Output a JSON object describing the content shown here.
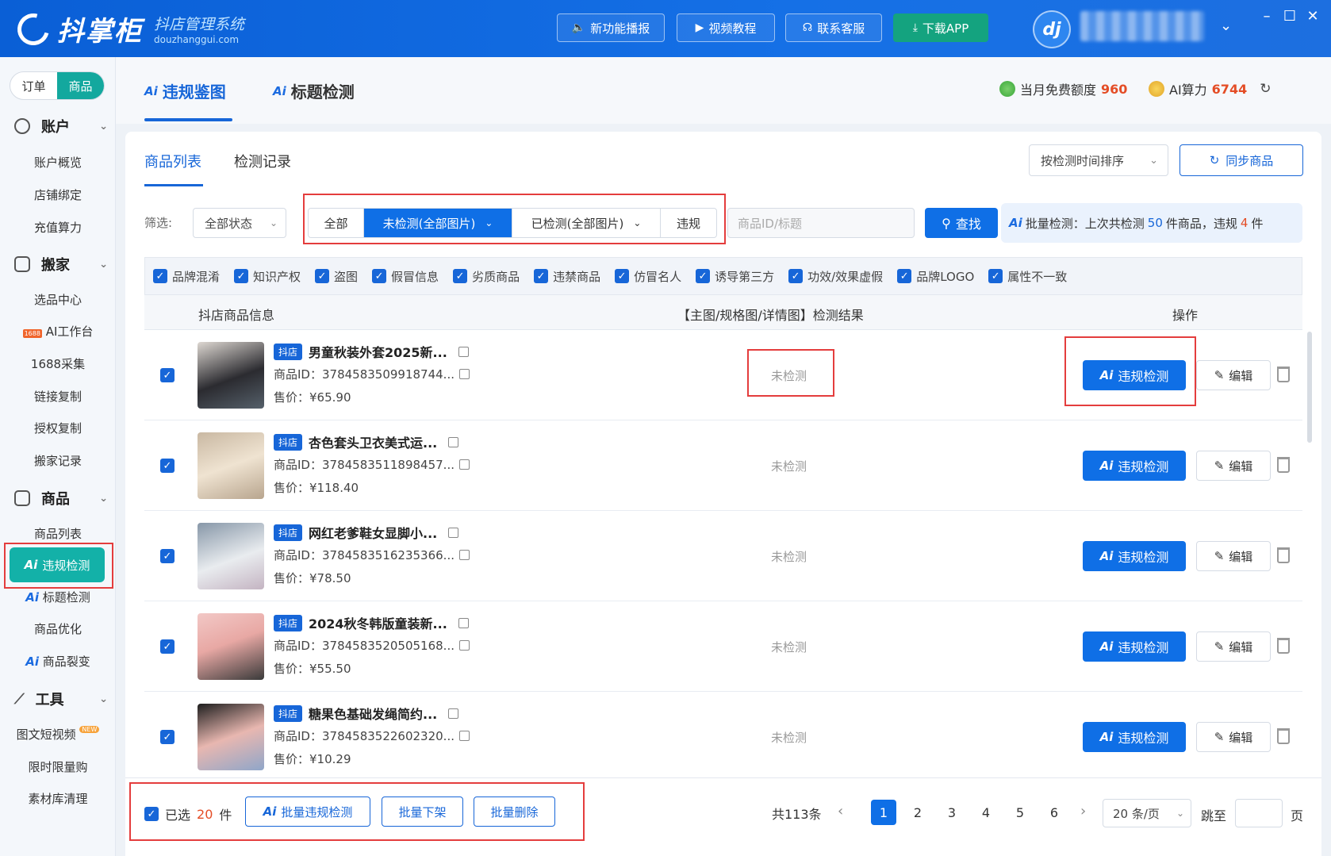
{
  "app": {
    "brand": "抖掌柜",
    "brand_sub": "抖店管理系统",
    "brand_domain": "douzhanggui.com",
    "toolbar": [
      {
        "label": "新功能播报",
        "icon": "speaker-icon"
      },
      {
        "label": "视频教程",
        "icon": "video-icon"
      },
      {
        "label": "联系客服",
        "icon": "headset-icon"
      },
      {
        "label": "下载APP",
        "icon": "download-icon"
      }
    ],
    "user_avatar_text": "dj"
  },
  "sidebar": {
    "segment": {
      "order": "订单",
      "product": "商品"
    },
    "sections": {
      "account": "账户",
      "move": "搬家",
      "goods": "商品",
      "tools": "工具"
    },
    "items": {
      "account_overview": "账户概览",
      "store_bind": "店铺绑定",
      "recharge": "充值算力",
      "select_center": "选品中心",
      "ai_workbench": "AI工作台",
      "collect_1688": "1688采集",
      "link_copy": "链接复制",
      "auth_copy": "授权复制",
      "move_record": "搬家记录",
      "product_list": "商品列表",
      "violation_detect": "违规检测",
      "title_detect": "标题检测",
      "product_optimize": "商品优化",
      "product_split": "商品裂变",
      "short_video": "图文短视频",
      "new_badge": "NEW",
      "flash_sale": "限时限量购",
      "material_clean": "素材库清理"
    },
    "ai_prefix": "Ai",
    "badge_1688": "1688"
  },
  "topnav": {
    "tab_violation": "违规鉴图",
    "tab_title": "标题检测",
    "ai_prefix": "Ai",
    "free_quota_label": "当月免费额度",
    "free_quota_value": "960",
    "ai_power_label": "AI算力",
    "ai_power_value": "6744"
  },
  "content": {
    "tab_list": "商品列表",
    "tab_record": "检测记录",
    "sort_label": "按检测时间排序",
    "sync_label": "同步商品",
    "filter_label": "筛选:",
    "status_select": "全部状态",
    "filters": [
      "全部",
      "未检测(全部图片)",
      "已检测(全部图片)",
      "违规"
    ],
    "search_placeholder": "商品ID/标题",
    "search_button": "查找",
    "batch_info": {
      "prefix": "批量检测：上次共检测",
      "count": "50",
      "mid": "件商品，违规",
      "violations": "4",
      "suffix": "件"
    },
    "categories": [
      "品牌混淆",
      "知识产权",
      "盗图",
      "假冒信息",
      "劣质商品",
      "违禁商品",
      "仿冒名人",
      "诱导第三方",
      "功效/效果虚假",
      "品牌LOGO",
      "属性不一致"
    ],
    "columns": {
      "info": "抖店商品信息",
      "result": "【主图/规格图/详情图】检测结果",
      "action": "操作"
    },
    "row_labels": {
      "tag": "抖店",
      "id_prefix": "商品ID：",
      "price_prefix": "售价：",
      "detect_button": "违规检测",
      "edit_button": "编辑"
    },
    "rows": [
      {
        "title": "男童秋装外套2025新...",
        "id": "3784583509918744...",
        "price": "¥65.90",
        "status": "未检测"
      },
      {
        "title": "杏色套头卫衣美式运...",
        "id": "3784583511898457...",
        "price": "¥118.40",
        "status": "未检测"
      },
      {
        "title": "网红老爹鞋女显脚小...",
        "id": "3784583516235366...",
        "price": "¥78.50",
        "status": "未检测"
      },
      {
        "title": "2024秋冬韩版童装新...",
        "id": "3784583520505168...",
        "price": "¥55.50",
        "status": "未检测"
      },
      {
        "title": "糖果色基础发绳简约...",
        "id": "3784583522602320...",
        "price": "¥10.29",
        "status": "未检测"
      }
    ]
  },
  "footer": {
    "selected_prefix": "已选",
    "selected_count": "20",
    "selected_suffix": "件",
    "batch_detect": "批量违规检测",
    "batch_offshelf": "批量下架",
    "batch_delete": "批量删除",
    "total": "共113条",
    "pages": [
      "1",
      "2",
      "3",
      "4",
      "5",
      "6"
    ],
    "page_size": "20 条/页",
    "jump_label": "跳至",
    "page_word": "页"
  },
  "colors": {
    "brand_blue": "#0f6fe6",
    "teal": "#13b1a8",
    "highlight": "#e43d3d",
    "accent_red": "#e44d26"
  }
}
